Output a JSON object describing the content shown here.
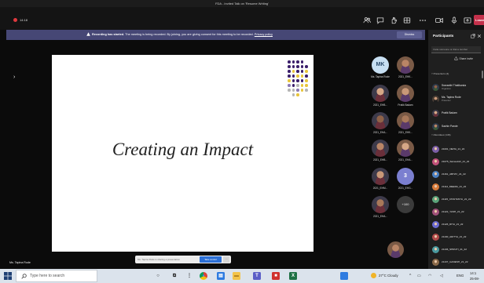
{
  "window": {
    "title": "FDA - Invited Talk on 'Resume Writing'"
  },
  "colors": {
    "recording": "#e0393e",
    "leave": "#c4314b",
    "banner": "#464775",
    "accent": "#2b6fd6"
  },
  "top_bar": {
    "recording_time": "14:18",
    "icons": [
      "people-icon",
      "chat-icon",
      "raise-hand-icon",
      "breakout-rooms-icon",
      "more-icon",
      "camera-icon",
      "mic-icon",
      "share-screen-icon"
    ],
    "leave_label": "Leave"
  },
  "banner": {
    "icon": "warning-icon",
    "bold": "Recording has started.",
    "text": "The meeting is being recorded. By joining, you are giving consent for this meeting to be recorded.",
    "link": "Privacy policy",
    "dismiss_label": "Dismiss"
  },
  "stage": {
    "slide_title": "Creating an Impact",
    "share_bar_text": "Ms. Tapina Rode is sharing a presentation",
    "share_bar_button": "Take control",
    "share_bar_more": "...",
    "presenter_name": "Ms. Tapina Rode"
  },
  "gallery": {
    "tiles": [
      {
        "initials": "MK",
        "name": "Ms. Tapina Rode"
      },
      {
        "initials": "",
        "name": "2021_EHK..."
      },
      {
        "initials": "",
        "name": "2021_EHB..."
      },
      {
        "initials": "",
        "name": "Pratik Badam"
      },
      {
        "initials": "",
        "name": "2021_EHA..."
      },
      {
        "initials": "",
        "name": "2021_EHK..."
      },
      {
        "initials": "",
        "name": "2021_EHB..."
      },
      {
        "initials": "",
        "name": "2021_EHA..."
      },
      {
        "initials": "",
        "name": "2021_EHM..."
      },
      {
        "initials": "3",
        "name": "2021_EHG..."
      },
      {
        "initials": "",
        "name": "2021_EHA..."
      }
    ],
    "overflow_label": "+100"
  },
  "participants_panel": {
    "title": "Participants",
    "invite_placeholder": "Invite someone or dial a number",
    "share_invite_label": "Share invite",
    "presenters_header": "Presenters (4)",
    "presenters": [
      {
        "name": "Sravanthi Thatikonda",
        "role": "Organizer"
      },
      {
        "name": "Ms. Tapina Rode",
        "role": "Presenter"
      },
      {
        "name": "Pratik Badam",
        "role": ""
      },
      {
        "name": "Sachin Pande",
        "role": ""
      }
    ],
    "attendees_header": "Attendees (146)",
    "attendees": [
      "21001_NEHA_21_22",
      "21075_Sameeksh_21_22",
      "21161_ABHAY_21_22",
      "21114_MEERA_21_22",
      "21115_CHAITANYA_21_22",
      "21122_YASH_21_22",
      "21126_RIYA_21_22",
      "21130_ADITYA_21_22",
      "21136_SHRUTI_21_22",
      "21137_GANESH_21_22"
    ]
  },
  "taskbar": {
    "search_placeholder": "Type here to search",
    "pinned": [
      "cortana-icon",
      "task-view-icon",
      "widgets-icon",
      "chrome-icon",
      "store-icon",
      "file-explorer-icon",
      "teams-icon",
      "pdf-icon",
      "excel-icon"
    ],
    "weather": "27°C Cloudy",
    "language": "ENG",
    "time": "14:1",
    "date": "25-08-"
  }
}
